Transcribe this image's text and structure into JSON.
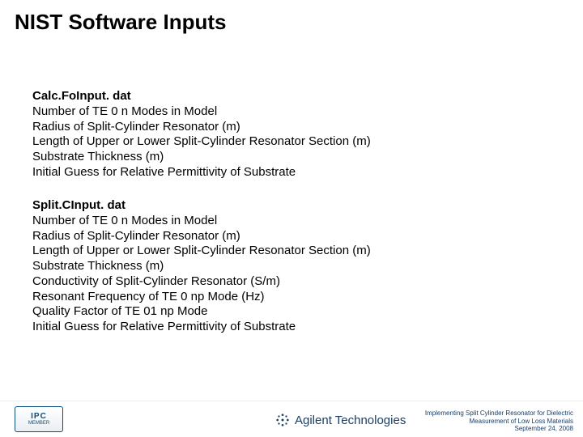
{
  "title": "NIST Software Inputs",
  "block1": {
    "heading": "Calc.FoInput. dat",
    "items": [
      "Number of TE 0 n Modes in Model",
      "Radius of Split-Cylinder Resonator (m)",
      "Length of Upper or Lower Split-Cylinder Resonator Section (m)",
      "Substrate Thickness (m)",
      "Initial Guess for Relative Permittivity of Substrate"
    ]
  },
  "block2": {
    "heading": "Split.CInput. dat",
    "items": [
      "Number of TE 0 n Modes in Model",
      "Radius of Split-Cylinder Resonator (m)",
      "Length of Upper or Lower Split-Cylinder Resonator Section (m)",
      "Substrate Thickness (m)",
      "Conductivity of Split-Cylinder Resonator (S/m)",
      "Resonant Frequency of TE 0 np Mode (Hz)",
      "Quality Factor of TE 01 np Mode",
      "Initial Guess for Relative Permittivity of Substrate"
    ]
  },
  "footer": {
    "ipc_top": "IPC",
    "ipc_bottom": "MEMBER",
    "agilent": "Agilent Technologies",
    "lines": [
      "Implementing Split Cylinder Resonator for Dielectric",
      "Measurement of Low Loss Materials",
      "September 24, 2008"
    ]
  }
}
